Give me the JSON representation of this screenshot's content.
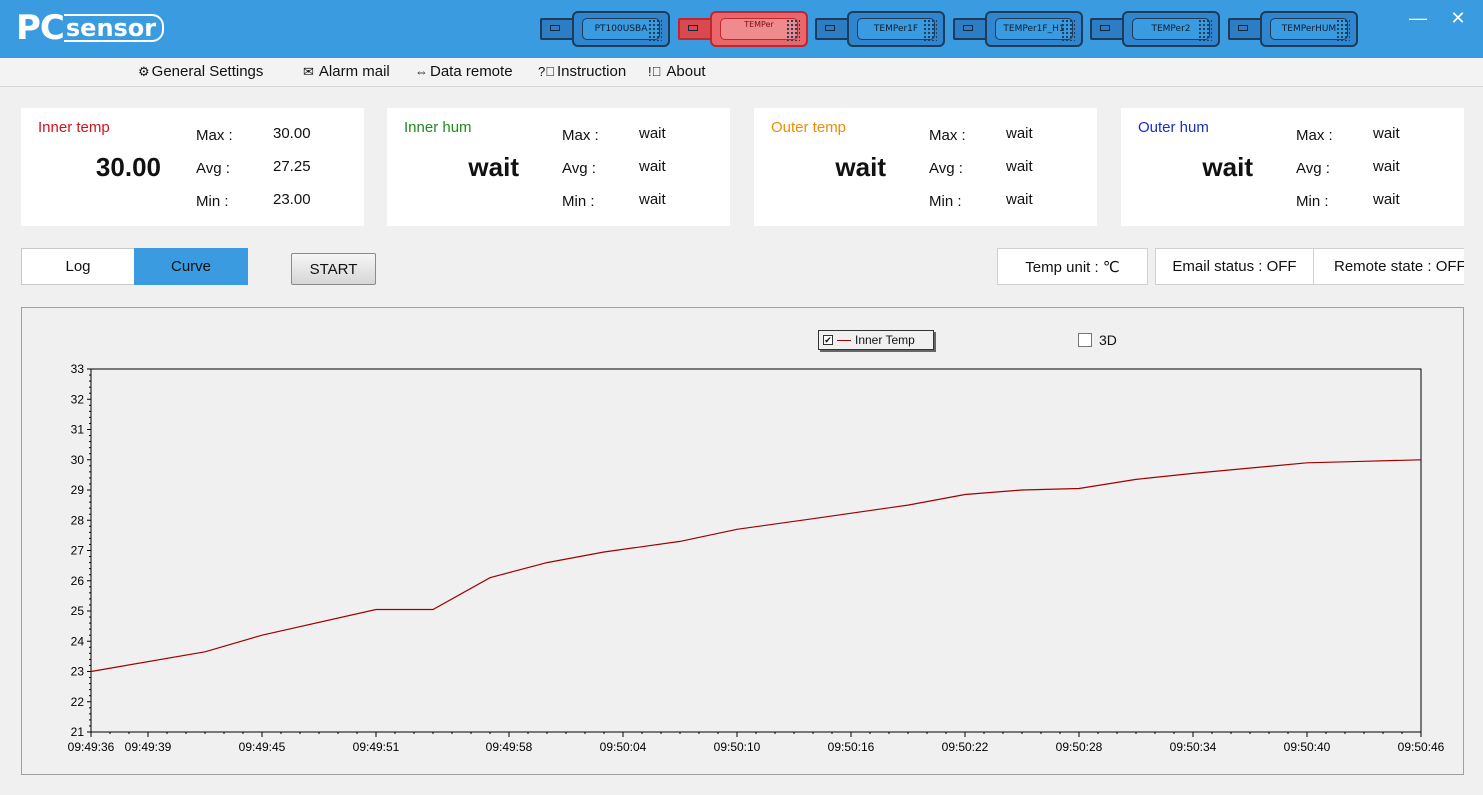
{
  "header": {
    "logo_pc": "PC",
    "logo_sensor": "sensor",
    "devices": [
      {
        "label": "PT100USBA",
        "active": false
      },
      {
        "label": "TEMPer",
        "active": true
      },
      {
        "label": "TEMPer1F",
        "active": false
      },
      {
        "label": "TEMPer1F_H1",
        "active": false
      },
      {
        "label": "TEMPer2",
        "active": false
      },
      {
        "label": "TEMPerHUM",
        "active": false
      }
    ],
    "minimize": "—",
    "close": "✕"
  },
  "menu": {
    "general_settings": "General Settings",
    "alarm_mail": "Alarm mail",
    "data_remote": "Data remote",
    "instruction": "Instruction",
    "about": "About"
  },
  "cards": [
    {
      "name": "Inner temp",
      "color": "#d0141c",
      "value": "30.00",
      "max_label": "Max :",
      "max": "30.00",
      "avg_label": "Avg :",
      "avg": "27.25",
      "min_label": "Min :",
      "min": "23.00"
    },
    {
      "name": "Inner hum",
      "color": "#1e8a1e",
      "value": "wait",
      "max_label": "Max :",
      "max": "wait",
      "avg_label": "Avg :",
      "avg": "wait",
      "min_label": "Min :",
      "min": "wait"
    },
    {
      "name": "Outer temp",
      "color": "#f08c00",
      "value": "wait",
      "max_label": "Max :",
      "max": "wait",
      "avg_label": "Avg :",
      "avg": "wait",
      "min_label": "Min :",
      "min": "wait"
    },
    {
      "name": "Outer hum",
      "color": "#1a2fc2",
      "value": "wait",
      "max_label": "Max :",
      "max": "wait",
      "avg_label": "Avg :",
      "avg": "wait",
      "min_label": "Min :",
      "min": "wait"
    }
  ],
  "tabs": {
    "log": "Log",
    "curve": "Curve"
  },
  "start_button": "START",
  "status": {
    "temp_unit": "Temp unit : ℃",
    "email_status": "Email status : OFF",
    "remote_state": "Remote state : OFF"
  },
  "chart_data": {
    "type": "line",
    "legend": "Inner Temp",
    "legend_checked": true,
    "option_3d_label": "3D",
    "option_3d_checked": false,
    "ylim": [
      21,
      33
    ],
    "yticks": [
      21,
      22,
      23,
      24,
      25,
      26,
      27,
      28,
      29,
      30,
      31,
      32,
      33
    ],
    "xlim_seconds": [
      0,
      70
    ],
    "xticks": [
      {
        "t": 0,
        "label": "09:49:36"
      },
      {
        "t": 3,
        "label": "09:49:39"
      },
      {
        "t": 9,
        "label": "09:49:45"
      },
      {
        "t": 15,
        "label": "09:49:51"
      },
      {
        "t": 22,
        "label": "09:49:58"
      },
      {
        "t": 28,
        "label": "09:50:04"
      },
      {
        "t": 34,
        "label": "09:50:10"
      },
      {
        "t": 40,
        "label": "09:50:16"
      },
      {
        "t": 46,
        "label": "09:50:22"
      },
      {
        "t": 52,
        "label": "09:50:28"
      },
      {
        "t": 58,
        "label": "09:50:34"
      },
      {
        "t": 64,
        "label": "09:50:40"
      },
      {
        "t": 70,
        "label": "09:50:46"
      }
    ],
    "series": [
      {
        "name": "Inner Temp",
        "color": "#a00000",
        "points": [
          [
            0,
            23.0
          ],
          [
            6,
            23.65
          ],
          [
            9,
            24.2
          ],
          [
            15,
            25.05
          ],
          [
            18,
            25.05
          ],
          [
            21,
            26.1
          ],
          [
            24,
            26.6
          ],
          [
            27,
            26.95
          ],
          [
            31,
            27.3
          ],
          [
            34,
            27.7
          ],
          [
            38,
            28.05
          ],
          [
            43,
            28.5
          ],
          [
            46,
            28.85
          ],
          [
            49,
            29.0
          ],
          [
            52,
            29.05
          ],
          [
            55,
            29.35
          ],
          [
            58,
            29.55
          ],
          [
            64,
            29.9
          ],
          [
            67,
            29.95
          ],
          [
            70,
            30.0
          ]
        ]
      }
    ]
  }
}
